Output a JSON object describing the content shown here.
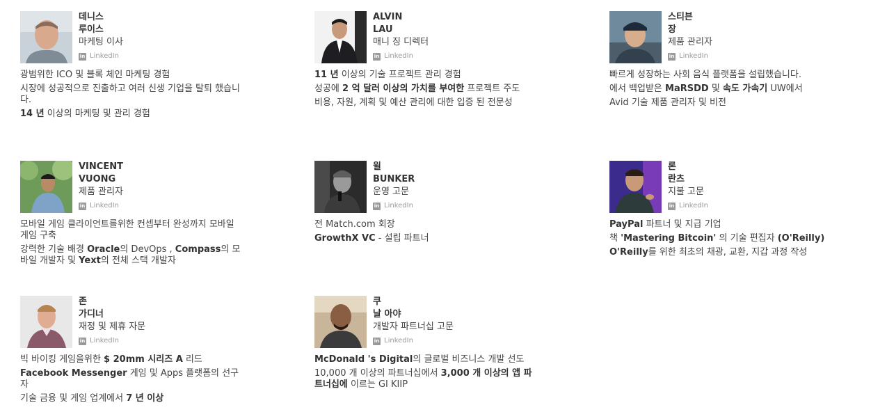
{
  "linkedin_label": "LinkedIn",
  "team": [
    {
      "name": [
        "데니스",
        "루이스"
      ],
      "role": "마케팅 이사",
      "bullets": [
        [
          {
            "t": "광범위한 ICO 및 블록 체인 마케팅 경험"
          }
        ],
        [
          {
            "t": "시장에 성공적으로 진출하고 여러 신생 기업을 탈퇴 했습니다."
          }
        ],
        [
          {
            "t": "14 년",
            "b": true
          },
          {
            "t": " 이상의 마케팅 및 관리 경험"
          }
        ]
      ]
    },
    {
      "name": [
        "ALVIN",
        "LAU"
      ],
      "role": "매니 징 디렉터",
      "bullets": [
        [
          {
            "t": "11 년",
            "b": true
          },
          {
            "t": " 이상의 기술 프로젝트 관리 경험"
          }
        ],
        [
          {
            "t": "성공에 "
          },
          {
            "t": "2 억 달러 이상의 가치를 부여한",
            "b": true
          },
          {
            "t": " 프로젝트 주도"
          }
        ],
        [
          {
            "t": "비용, 자원, 계획 및 예산 관리에 대한 입증 된 전문성"
          }
        ]
      ]
    },
    {
      "name": [
        "스티븐",
        "장"
      ],
      "role": "제품 관리자",
      "bullets": [
        [
          {
            "t": "빠르게 성장하는 사회 음식 플랫폼을 설립했습니다."
          }
        ],
        [
          {
            "t": "에서 백업받은 "
          },
          {
            "t": "MaRSDD",
            "b": true
          },
          {
            "t": " 및 "
          },
          {
            "t": "속도 가속기",
            "b": true
          },
          {
            "t": " UW에서"
          }
        ],
        [
          {
            "t": "Avid 기술 제품 관리자 및 비전"
          }
        ]
      ]
    },
    {
      "name": [
        "VINCENT",
        "VUONG"
      ],
      "role": "제품 관리자",
      "bullets": [
        [
          {
            "t": "모바일 게임 클라이언트를위한 컨셉부터 완성까지 모바일 게임 구축"
          }
        ],
        [
          {
            "t": "강력한 기술 배경 "
          },
          {
            "t": "Oracle",
            "b": true
          },
          {
            "t": "의 DevOps , "
          },
          {
            "t": "Compass",
            "b": true
          },
          {
            "t": "의 모바일 개발자 및 "
          },
          {
            "t": "Yext",
            "b": true
          },
          {
            "t": "의 전체 스택 개발자"
          }
        ]
      ]
    },
    {
      "name": [
        "윌",
        "BUNKER"
      ],
      "role": "운영 고문",
      "bullets": [
        [
          {
            "t": "전 Match.com 회장"
          }
        ],
        [
          {
            "t": "GrowthX VC",
            "b": true
          },
          {
            "t": " - 설립 파트너"
          }
        ]
      ]
    },
    {
      "name": [
        "론",
        "란츠"
      ],
      "role": "지불 고문",
      "bullets": [
        [
          {
            "t": "PayPal",
            "b": true
          },
          {
            "t": " 파트너 및 지급 기업"
          }
        ],
        [
          {
            "t": "책 "
          },
          {
            "t": "'Mastering Bitcoin'",
            "b": true
          },
          {
            "t": " 의 기술 편집자 "
          },
          {
            "t": "(O'Reilly)",
            "b": true
          }
        ],
        [
          {
            "t": "O'Reilly",
            "b": true
          },
          {
            "t": "를 위한 최초의 채광, 교환, 지갑 과정 작성"
          }
        ]
      ]
    },
    {
      "name": [
        "존",
        "가디너"
      ],
      "role": "재정 및 제휴 자문",
      "bullets": [
        [
          {
            "t": "빅 바이킹 게임을위한 "
          },
          {
            "t": "$ 20mm 시리즈 A",
            "b": true
          },
          {
            "t": " 리드"
          }
        ],
        [
          {
            "t": "Facebook Messenger",
            "b": true
          },
          {
            "t": " 게임 및 Apps 플랫폼의 선구자"
          }
        ],
        [
          {
            "t": "기술 금융 및 게임 업계에서 "
          },
          {
            "t": "7 년 이상",
            "b": true
          }
        ]
      ]
    },
    {
      "name": [
        "쿠",
        "날 아야"
      ],
      "role": "개발자 파트너십 고문",
      "bullets": [
        [
          {
            "t": "McDonald 's Digital",
            "b": true
          },
          {
            "t": "의 글로벌 비즈니스 개발 선도"
          }
        ],
        [
          {
            "t": "10,000 개 이상의 파트너십에서 "
          },
          {
            "t": "3,000 개 이상의 앱 파트너십에",
            "b": true
          },
          {
            "t": " 이르는 GI KIIP"
          }
        ]
      ]
    }
  ]
}
